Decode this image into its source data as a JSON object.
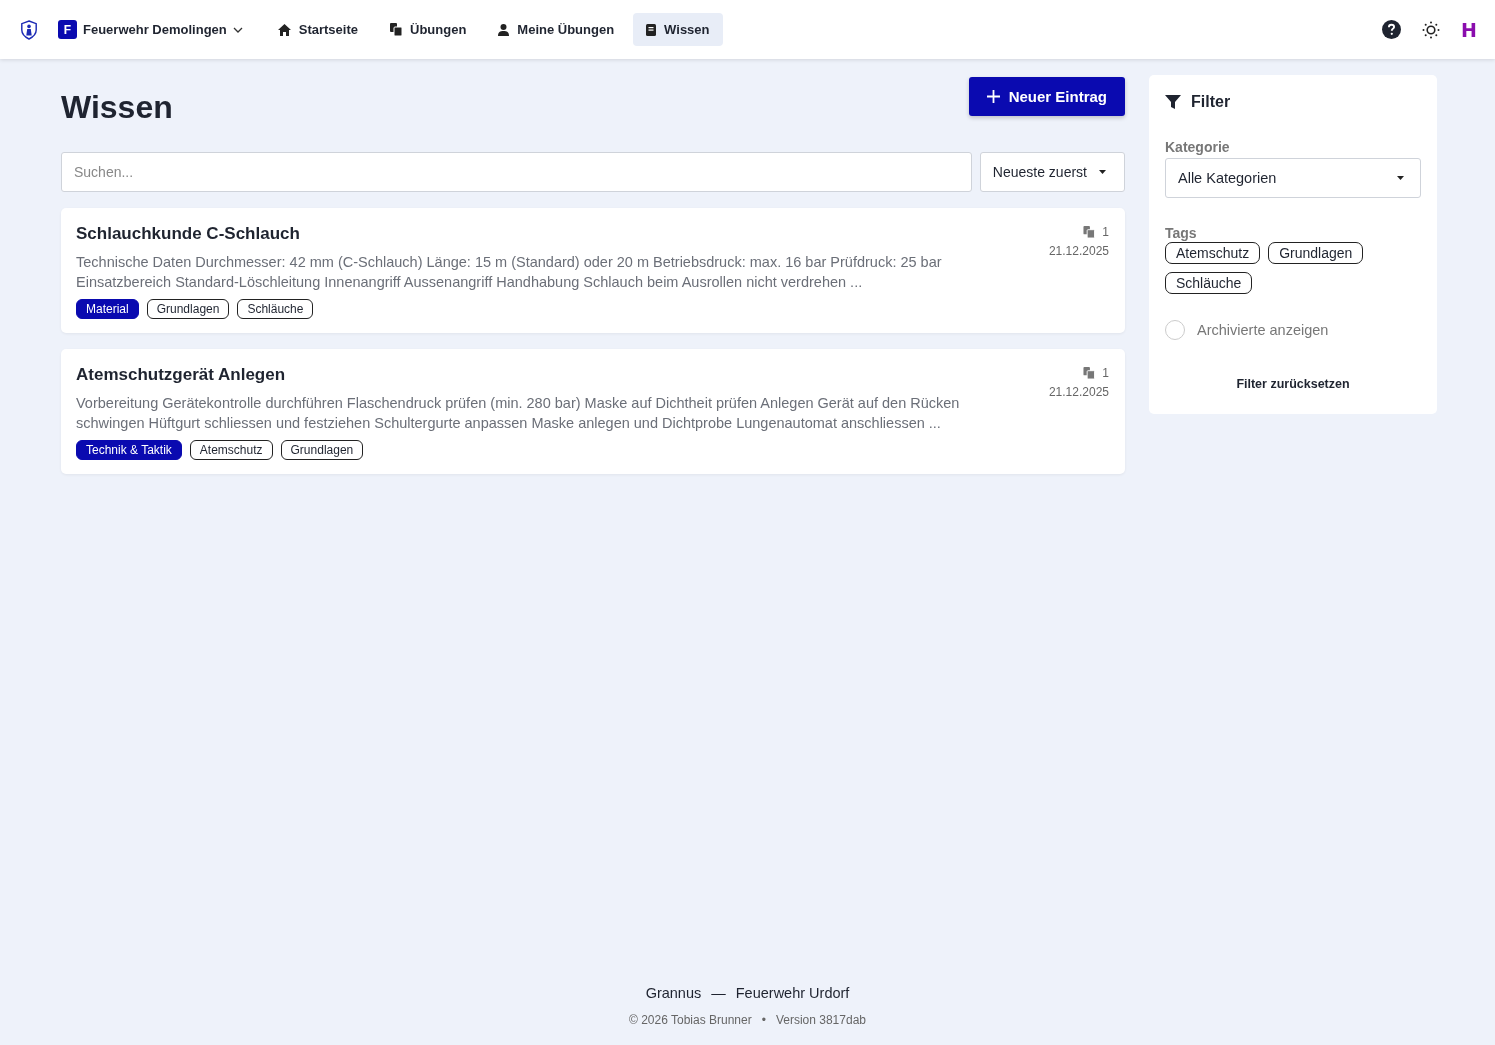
{
  "nav": {
    "org_initial": "F",
    "org_name": "Feuerwehr Demolingen",
    "items": [
      {
        "label": "Startseite",
        "kind": "home",
        "selected": false
      },
      {
        "label": "Übungen",
        "kind": "exercises",
        "selected": false
      },
      {
        "label": "Meine Übungen",
        "kind": "personal",
        "selected": false
      },
      {
        "label": "Wissen",
        "kind": "knowledge",
        "selected": true
      }
    ],
    "avatar_initial": "H"
  },
  "page": {
    "title": "Wissen",
    "new_button": "Neuer Eintrag",
    "search": {
      "placeholder": "Suchen..."
    },
    "sort": "Neueste zuerst"
  },
  "entries": [
    {
      "title": "Schlauchkunde C-Schlauch",
      "description": "Technische Daten Durchmesser: 42 mm (C-Schlauch) Länge: 15 m (Standard) oder 20 m Betriebsdruck: max. 16 bar Prüfdruck: 25 bar Einsatzbereich Standard-Löschleitung Innenangriff Aussenangriff Handhabung Schlauch beim Ausrollen nicht verdrehen ...",
      "count": "1",
      "date": "21.12.2025",
      "tags": [
        {
          "label": "Material",
          "kind": "category"
        },
        {
          "label": "Grundlagen",
          "kind": "tag"
        },
        {
          "label": "Schläuche",
          "kind": "tag"
        }
      ]
    },
    {
      "title": "Atemschutzgerät Anlegen",
      "description": "Vorbereitung Gerätekontrolle durchführen Flaschendruck prüfen (min. 280 bar) Maske auf Dichtheit prüfen Anlegen Gerät auf den Rücken schwingen Hüftgurt schliessen und festziehen Schultergurte anpassen Maske anlegen und Dichtprobe Lungenautomat anschliessen ...",
      "count": "1",
      "date": "21.12.2025",
      "tags": [
        {
          "label": "Technik & Taktik",
          "kind": "category"
        },
        {
          "label": "Atemschutz",
          "kind": "tag"
        },
        {
          "label": "Grundlagen",
          "kind": "tag"
        }
      ]
    }
  ],
  "filter": {
    "title": "Filter",
    "category_label": "Kategorie",
    "category_value": "Alle Kategorien",
    "tags_label": "Tags",
    "tags": [
      {
        "label": "Atemschutz",
        "selected": false
      },
      {
        "label": "Grundlagen",
        "selected": false
      },
      {
        "label": "Schläuche",
        "selected": false
      }
    ],
    "archived": {
      "label": "Archivierte anzeigen",
      "checked": false
    },
    "reset": "Filter zurücksetzen"
  },
  "footer": {
    "app": "Grannus",
    "separator": "—",
    "org": "Feuerwehr Urdorf",
    "copyright": "© 2026 Tobias Brunner",
    "dot": "•",
    "version": "Version 3817dab"
  }
}
